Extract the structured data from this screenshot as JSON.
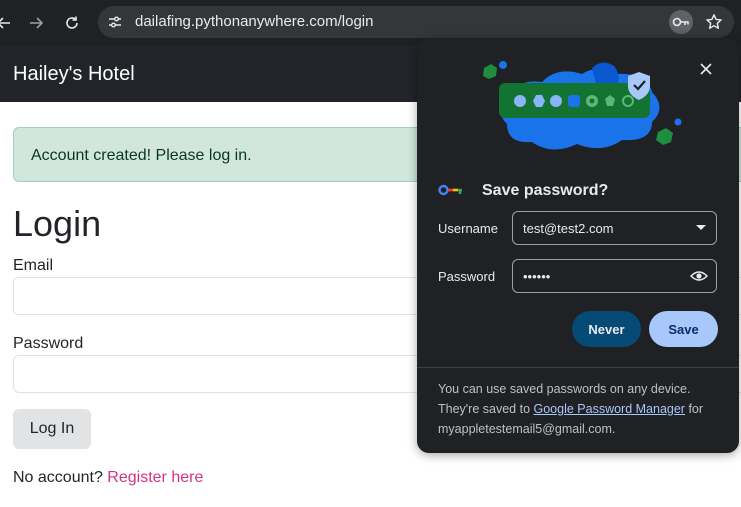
{
  "browser": {
    "url": "dailafing.pythonanywhere.com/login"
  },
  "navbar": {
    "brand": "Hailey's Hotel"
  },
  "alert": {
    "message": "Account created! Please log in."
  },
  "form": {
    "title": "Login",
    "email_label": "Email",
    "email_value": "",
    "password_label": "Password",
    "password_value": "",
    "submit_label": "Log In",
    "register_prompt": "No account?",
    "register_link": "Register here"
  },
  "popup": {
    "title": "Save password?",
    "username_label": "Username",
    "username_value": "test@test2.com",
    "password_label": "Password",
    "password_value": "••••••",
    "never_label": "Never",
    "save_label": "Save",
    "footer_text_1": "You can use saved passwords on any device. They're saved to ",
    "footer_link": "Google Password Manager",
    "footer_text_2": " for myappletestemail5@gmail.com."
  },
  "colors": {
    "chrome_bg": "#202124",
    "navbar_bg": "#212529",
    "alert_bg": "#d1e7dd",
    "link_pink": "#d63384",
    "save_button": "#a8c7fa",
    "never_button": "#064a76"
  },
  "icons": [
    "back-icon",
    "forward-icon",
    "reload-icon",
    "site-info-icon",
    "password-key-icon",
    "bookmark-star-icon",
    "close-icon",
    "google-key-icon",
    "dropdown-caret-icon",
    "show-password-icon"
  ]
}
